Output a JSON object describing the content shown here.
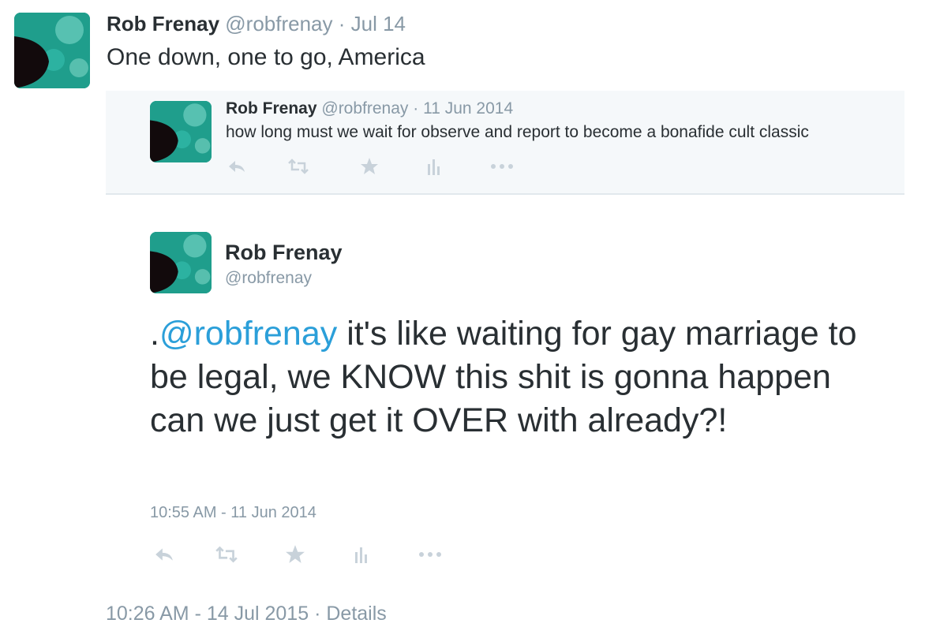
{
  "tweet": {
    "author_name": "Rob Frenay",
    "author_handle": "@robfrenay",
    "separator": "·",
    "date": "Jul 14",
    "text": "One down, one to go, America",
    "timestamp": "10:26 AM - 14 Jul 2015",
    "details_label": "Details"
  },
  "quoted_tweet": {
    "author_name": "Rob Frenay",
    "author_handle": "@robfrenay",
    "separator": "·",
    "date": "11 Jun 2014",
    "text": "how long must we wait for observe and report to become a bonafide cult classic",
    "actions": [
      "reply-icon",
      "retweet-icon",
      "favorite-star-icon",
      "analytics-icon",
      "more-icon"
    ]
  },
  "embedded_reply": {
    "author_name": "Rob Frenay",
    "author_handle": "@robfrenay",
    "text_prefix": ".",
    "mention": "@robfrenay",
    "text_body": " it's like waiting for gay marriage to be legal, we KNOW this shit is gonna happen can we just get it OVER with already?!",
    "timestamp": "10:55 AM - 11 Jun 2014",
    "actions": [
      "reply-icon",
      "retweet-icon",
      "favorite-star-icon",
      "analytics-icon",
      "more-icon"
    ]
  },
  "colors": {
    "text": "#292f33",
    "muted": "#8899a6",
    "mention": "#2b9fd9",
    "quote_bg": "#f5f8fa",
    "icon": "#bcc6cf"
  }
}
